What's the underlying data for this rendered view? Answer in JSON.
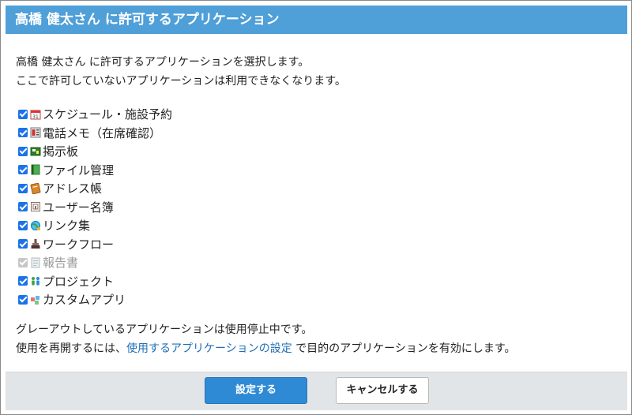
{
  "header": {
    "title": "高橋 健太さん に許可するアプリケーション"
  },
  "description": {
    "line1": "高橋 健太さん に許可するアプリケーションを選択します。",
    "line2": "ここで許可していないアプリケーションは利用できなくなります。"
  },
  "apps": [
    {
      "label": "スケジュール・施設予約",
      "checked": true,
      "disabled": false,
      "icon": "calendar-icon"
    },
    {
      "label": "電話メモ（在席確認）",
      "checked": true,
      "disabled": false,
      "icon": "phone-memo-icon"
    },
    {
      "label": "掲示板",
      "checked": true,
      "disabled": false,
      "icon": "bulletin-board-icon"
    },
    {
      "label": "ファイル管理",
      "checked": true,
      "disabled": false,
      "icon": "file-management-icon"
    },
    {
      "label": "アドレス帳",
      "checked": true,
      "disabled": false,
      "icon": "address-book-icon"
    },
    {
      "label": "ユーザー名簿",
      "checked": true,
      "disabled": false,
      "icon": "user-directory-icon"
    },
    {
      "label": "リンク集",
      "checked": true,
      "disabled": false,
      "icon": "link-globe-icon"
    },
    {
      "label": "ワークフロー",
      "checked": true,
      "disabled": false,
      "icon": "workflow-stamp-icon"
    },
    {
      "label": "報告書",
      "checked": true,
      "disabled": true,
      "icon": "report-icon"
    },
    {
      "label": "プロジェクト",
      "checked": true,
      "disabled": false,
      "icon": "project-people-icon"
    },
    {
      "label": "カスタムアプリ",
      "checked": true,
      "disabled": false,
      "icon": "custom-app-icon"
    }
  ],
  "note": {
    "line1": "グレーアウトしているアプリケーションは使用停止中です。",
    "line2_prefix": "使用を再開するには、",
    "link": "使用するアプリケーションの設定",
    "line2_suffix": " で目的のアプリケーションを有効にします。"
  },
  "buttons": {
    "submit": "設定する",
    "cancel": "キャンセルする"
  },
  "colors": {
    "header_bg": "#4f9fd8",
    "primary": "#2f8ad6",
    "link": "#1f6eb4",
    "checkbox": "#1a73e8"
  }
}
